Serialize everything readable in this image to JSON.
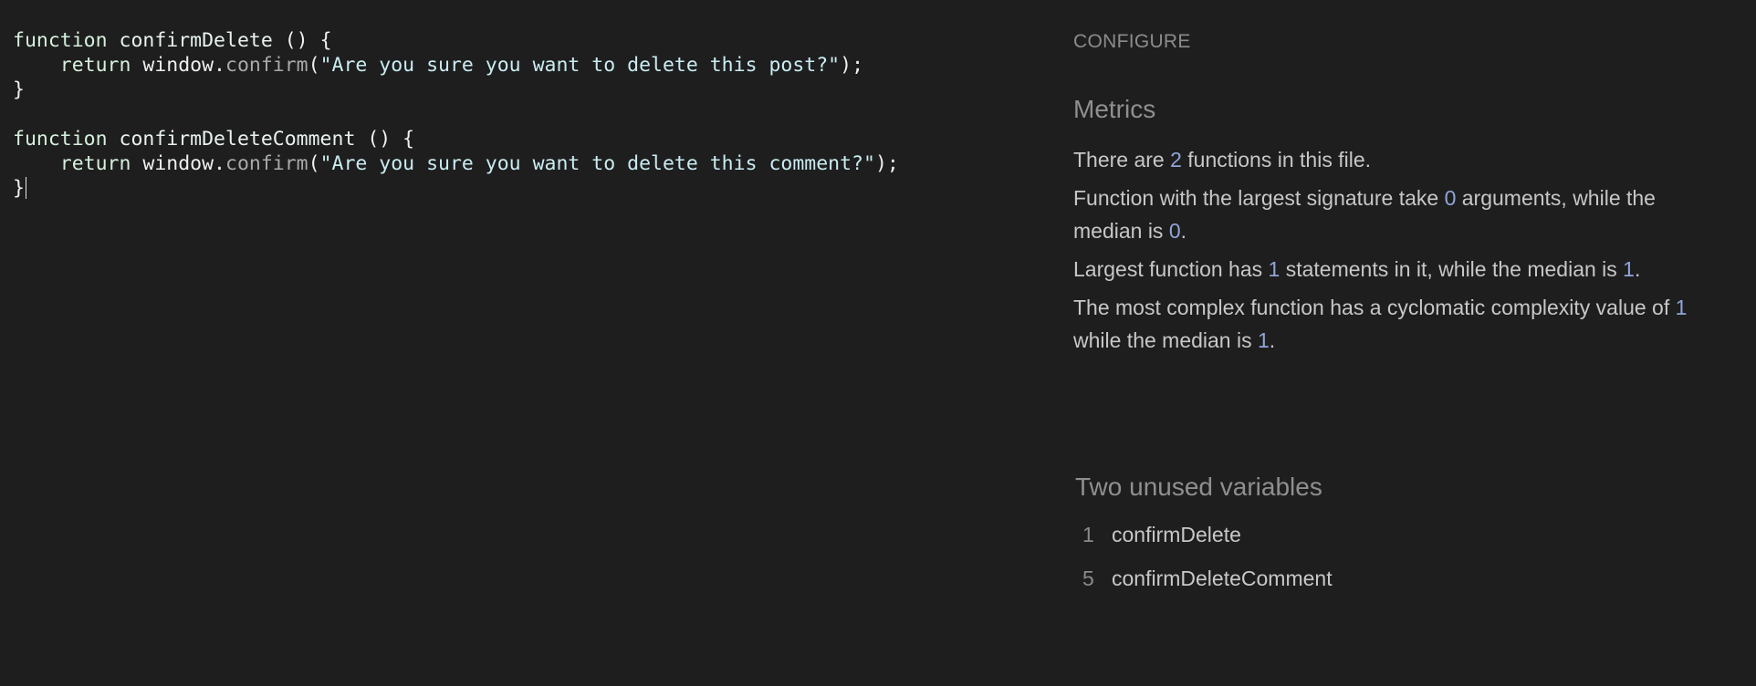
{
  "editor": {
    "lines": [
      {
        "kw": "function",
        "name": " confirmDelete",
        "rest": "() {"
      },
      {
        "indent": "    ",
        "kw": "return",
        "obj": " window.",
        "prop": "confirm",
        "open": "(",
        "str": "\"Are you sure you want to delete this post?\"",
        "close": ");"
      },
      {
        "punct": "}"
      },
      {
        "kw": "function",
        "name": " confirmDeleteComment",
        "rest": "() {"
      },
      {
        "indent": "    ",
        "kw": "return",
        "obj": " window.",
        "prop": "confirm",
        "open": "(",
        "str": "\"Are you sure you want to delete this comment?\"",
        "close": ");"
      },
      {
        "punct": "}"
      }
    ]
  },
  "panel": {
    "configure_label": "CONFIGURE",
    "metrics_title": "Metrics",
    "metrics": {
      "m1": {
        "a": "There are ",
        "n1": "2",
        "b": " functions in this file."
      },
      "m2": {
        "a": "Function with the largest signature take ",
        "n1": "0",
        "b": " arguments, while the median is ",
        "n2": "0",
        "c": "."
      },
      "m3": {
        "a": "Largest function has ",
        "n1": "1",
        "b": " statements in it, while the median is ",
        "n2": "1",
        "c": "."
      },
      "m4": {
        "a": "The most complex function has a cyclomatic complexity value of ",
        "n1": "1",
        "b": " while the median is ",
        "n2": "1",
        "c": "."
      }
    },
    "unused_title": "Two unused variables",
    "unused": [
      {
        "line": "1",
        "name": "confirmDelete"
      },
      {
        "line": "5",
        "name": "confirmDeleteComment"
      }
    ]
  },
  "colors": {
    "background": "#1e1e1e",
    "number_accent": "#8fa6d8",
    "muted_heading": "#8f8f8f"
  }
}
